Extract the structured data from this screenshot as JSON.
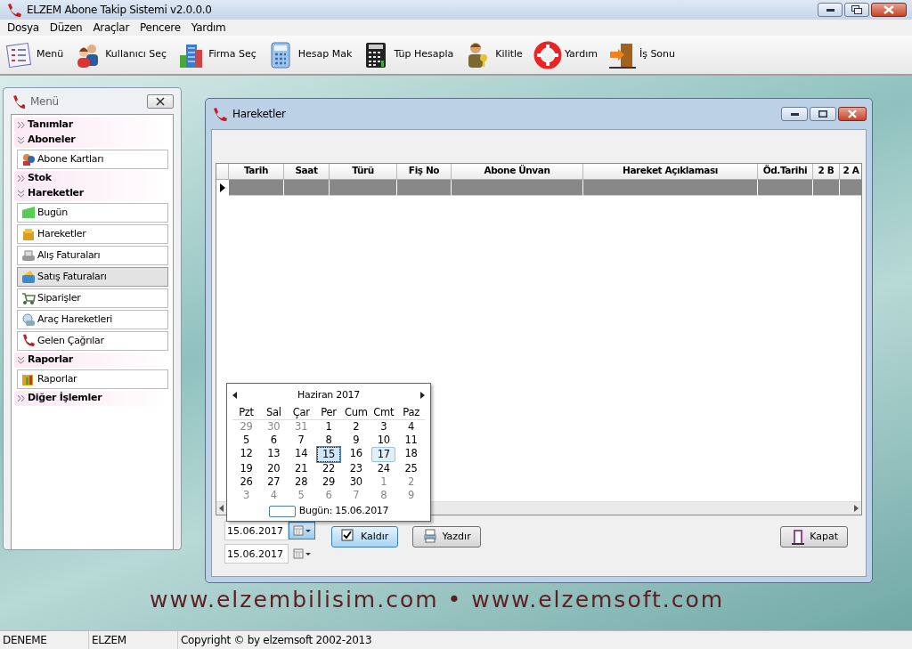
{
  "window": {
    "title": "ELZEM Abone Takip Sistemi v2.0.0.0"
  },
  "menu_bar": [
    "Dosya",
    "Düzen",
    "Araçlar",
    "Pencere",
    "Yardım"
  ],
  "toolbar": [
    "Menü",
    "Kullanıcı Seç",
    "Firma Seç",
    "Hesap Mak",
    "Tüp Hesapla",
    "Kilitle",
    "Yardım",
    "İş Sonu"
  ],
  "menu_panel": {
    "title": "Menü",
    "groups": [
      {
        "label": "Tanımlar",
        "expanded": false
      },
      {
        "label": "Aboneler",
        "expanded": true,
        "children": [
          {
            "label": "Abone Kartları",
            "selected": false
          }
        ]
      },
      {
        "label": "Stok",
        "expanded": false
      },
      {
        "label": "Hareketler",
        "expanded": true,
        "children": [
          {
            "label": "Bugün",
            "selected": false
          },
          {
            "label": "Hareketler",
            "selected": false
          },
          {
            "label": "Alış Faturaları",
            "selected": false
          },
          {
            "label": "Satış Faturaları",
            "selected": true
          },
          {
            "label": "Siparişler",
            "selected": false
          },
          {
            "label": "Araç Hareketleri",
            "selected": false
          },
          {
            "label": "Gelen Çağrılar",
            "selected": false
          }
        ]
      },
      {
        "label": "Raporlar",
        "expanded": true,
        "children": [
          {
            "label": "Raporlar",
            "selected": false
          }
        ]
      },
      {
        "label": "Diğer İşlemler",
        "expanded": false
      }
    ]
  },
  "child_window": {
    "title": "Hareketler",
    "table": {
      "columns": [
        "Tarih",
        "Saat",
        "Türü",
        "Fiş No",
        "Abone Ünvan",
        "Hareket Açıklaması",
        "Öd.Tarihi",
        "2 B",
        "2 A"
      ],
      "rows": [
        {
          "selected": true
        }
      ]
    },
    "date_fields": [
      {
        "value": "15.06.2017",
        "open": true
      },
      {
        "value": "15.06.2017",
        "open": false
      }
    ],
    "buttons": [
      {
        "label": "Kaldır",
        "default": true
      },
      {
        "label": "Yazdır",
        "default": false
      },
      {
        "label": "Kapat",
        "default": false
      }
    ]
  },
  "calendar": {
    "month": "Haziran 2017",
    "weekdays": [
      "Pzt",
      "Sal",
      "Çar",
      "Per",
      "Cum",
      "Cmt",
      "Paz"
    ],
    "days": [
      {
        "day": "29",
        "outside_month": true,
        "selected": false,
        "hovered": false
      },
      {
        "day": "30",
        "outside_month": true,
        "selected": false,
        "hovered": false
      },
      {
        "day": "31",
        "outside_month": true,
        "selected": false,
        "hovered": false
      },
      {
        "day": "1",
        "outside_month": false,
        "selected": false,
        "hovered": false
      },
      {
        "day": "2",
        "outside_month": false,
        "selected": false,
        "hovered": false
      },
      {
        "day": "3",
        "outside_month": false,
        "selected": false,
        "hovered": false
      },
      {
        "day": "4",
        "outside_month": false,
        "selected": false,
        "hovered": false
      },
      {
        "day": "5",
        "outside_month": false,
        "selected": false,
        "hovered": false
      },
      {
        "day": "6",
        "outside_month": false,
        "selected": false,
        "hovered": false
      },
      {
        "day": "7",
        "outside_month": false,
        "selected": false,
        "hovered": false
      },
      {
        "day": "8",
        "outside_month": false,
        "selected": false,
        "hovered": false
      },
      {
        "day": "9",
        "outside_month": false,
        "selected": false,
        "hovered": false
      },
      {
        "day": "10",
        "outside_month": false,
        "selected": false,
        "hovered": false
      },
      {
        "day": "11",
        "outside_month": false,
        "selected": false,
        "hovered": false
      },
      {
        "day": "12",
        "outside_month": false,
        "selected": false,
        "hovered": false
      },
      {
        "day": "13",
        "outside_month": false,
        "selected": false,
        "hovered": false
      },
      {
        "day": "14",
        "outside_month": false,
        "selected": false,
        "hovered": false
      },
      {
        "day": "15",
        "outside_month": false,
        "selected": true,
        "hovered": false
      },
      {
        "day": "16",
        "outside_month": false,
        "selected": false,
        "hovered": false
      },
      {
        "day": "17",
        "outside_month": false,
        "selected": false,
        "hovered": true
      },
      {
        "day": "18",
        "outside_month": false,
        "selected": false,
        "hovered": false
      },
      {
        "day": "19",
        "outside_month": false,
        "selected": false,
        "hovered": false
      },
      {
        "day": "20",
        "outside_month": false,
        "selected": false,
        "hovered": false
      },
      {
        "day": "21",
        "outside_month": false,
        "selected": false,
        "hovered": false
      },
      {
        "day": "22",
        "outside_month": false,
        "selected": false,
        "hovered": false
      },
      {
        "day": "23",
        "outside_month": false,
        "selected": false,
        "hovered": false
      },
      {
        "day": "24",
        "outside_month": false,
        "selected": false,
        "hovered": false
      },
      {
        "day": "25",
        "outside_month": false,
        "selected": false,
        "hovered": false
      },
      {
        "day": "26",
        "outside_month": false,
        "selected": false,
        "hovered": false
      },
      {
        "day": "27",
        "outside_month": false,
        "selected": false,
        "hovered": false
      },
      {
        "day": "28",
        "outside_month": false,
        "selected": false,
        "hovered": false
      },
      {
        "day": "29",
        "outside_month": false,
        "selected": false,
        "hovered": false
      },
      {
        "day": "30",
        "outside_month": false,
        "selected": false,
        "hovered": false
      },
      {
        "day": "1",
        "outside_month": true,
        "selected": false,
        "hovered": false
      },
      {
        "day": "2",
        "outside_month": true,
        "selected": false,
        "hovered": false
      },
      {
        "day": "3",
        "outside_month": true,
        "selected": false,
        "hovered": false
      },
      {
        "day": "4",
        "outside_month": true,
        "selected": false,
        "hovered": false
      },
      {
        "day": "5",
        "outside_month": true,
        "selected": false,
        "hovered": false
      },
      {
        "day": "6",
        "outside_month": true,
        "selected": false,
        "hovered": false
      },
      {
        "day": "7",
        "outside_month": true,
        "selected": false,
        "hovered": false
      },
      {
        "day": "8",
        "outside_month": true,
        "selected": false,
        "hovered": false
      },
      {
        "day": "9",
        "outside_month": true,
        "selected": false,
        "hovered": false
      }
    ],
    "today": "Bugün: 15.06.2017"
  },
  "background_text": "www.elzembilisim.com • www.elzemsoft.com",
  "status_bar": [
    "DENEME",
    "ELZEM",
    "Copyright © by elzemsoft 2002-2013"
  ]
}
